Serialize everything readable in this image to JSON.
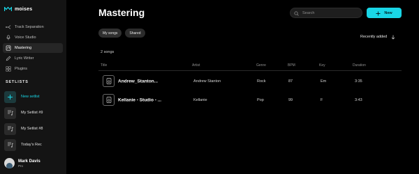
{
  "app": {
    "logo_text": "moises"
  },
  "sidebar": {
    "items": [
      {
        "label": "Track Separation",
        "icon": "split-icon",
        "active": false
      },
      {
        "label": "Voice Studio",
        "icon": "voice-icon",
        "active": false
      },
      {
        "label": "Mastering",
        "icon": "mastering-icon",
        "active": true
      },
      {
        "label": "Lyric Writer",
        "icon": "pen-icon",
        "active": false
      },
      {
        "label": "Plugins",
        "icon": "plugins-icon",
        "active": false
      }
    ],
    "setlists_title": "SETLISTS",
    "setlists": [
      {
        "label": "New setlist",
        "icon": "plus-icon"
      },
      {
        "label": "My Setlist #9",
        "icon": "music-list-icon"
      },
      {
        "label": "My Setlist #8",
        "icon": "music-list-icon"
      },
      {
        "label": "Today's Rec",
        "icon": "music-list-icon"
      }
    ],
    "user": {
      "name": "Mark Davis",
      "plan": "Pro"
    }
  },
  "main": {
    "title": "Mastering",
    "search": {
      "placeholder": "Search"
    },
    "new_button": "New",
    "filters": [
      "My songs",
      "Shared"
    ],
    "sort_label": "Recently added",
    "count_text": "2 songs",
    "columns": [
      "Title",
      "Artist",
      "Genre",
      "BPM",
      "Key",
      "Duration"
    ],
    "rows": [
      {
        "title": "Andrew_Stanton...",
        "artist": "Andrew Stanton",
        "genre": "Rock",
        "bpm": "87",
        "key": "Em",
        "duration": "3:35"
      },
      {
        "title": "Kellanie - Studio - ...",
        "artist": "Kellanie",
        "genre": "Pop",
        "bpm": "99",
        "key": "F",
        "duration": "3:43"
      }
    ]
  },
  "colors": {
    "accent": "#19d6e6",
    "background": "#000000",
    "sidebar": "#141414"
  }
}
